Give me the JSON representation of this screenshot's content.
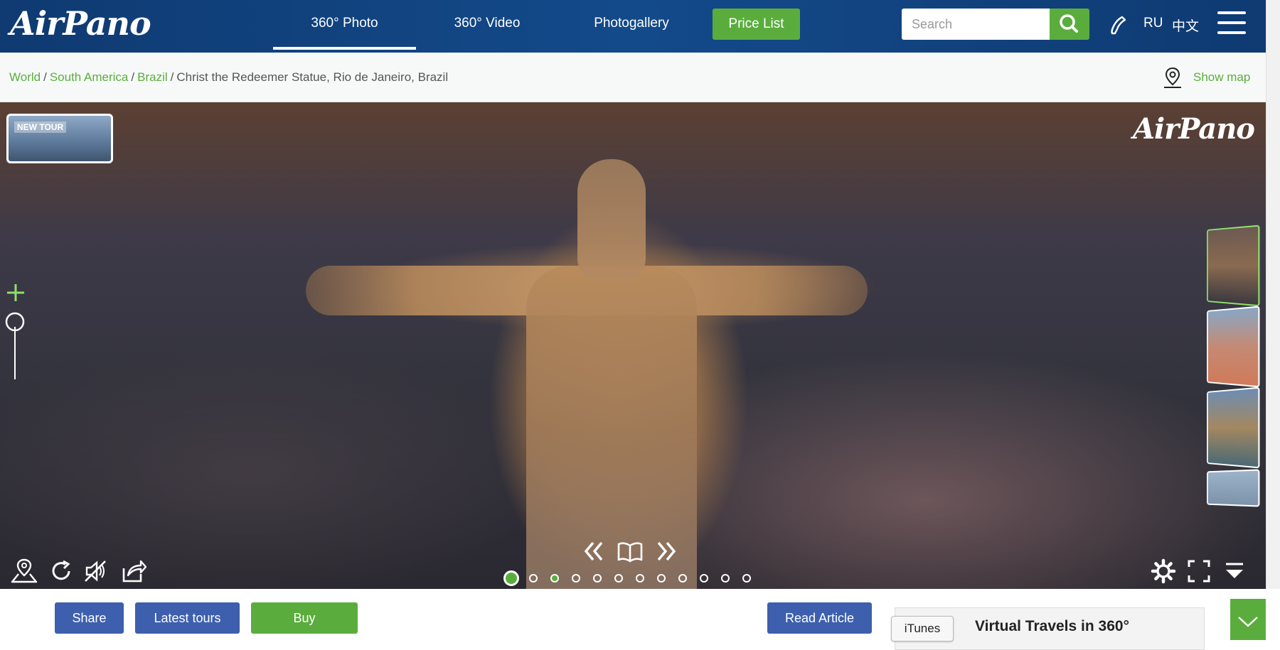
{
  "header": {
    "logo": "AirPano",
    "nav": [
      {
        "label": "360° Photo",
        "active": true
      },
      {
        "label": "360° Video",
        "active": false
      },
      {
        "label": "Photogallery",
        "active": false
      }
    ],
    "price_list": "Price List",
    "search": {
      "placeholder": "Search",
      "value": ""
    },
    "lang_ru": "RU",
    "lang_zh": "中文"
  },
  "breadcrumb": {
    "items": [
      "World",
      "South America",
      "Brazil"
    ],
    "current": "Christ the Redeemer Statue, Rio de Janeiro, Brazil",
    "separator": "/"
  },
  "show_map": "Show map",
  "viewer": {
    "new_tour_label": "NEW TOUR",
    "logo": "AirPano",
    "pager": {
      "total": 12,
      "current": 1,
      "seen": [
        3
      ]
    }
  },
  "bottom": {
    "share": "Share",
    "latest_tours": "Latest tours",
    "buy": "Buy",
    "read_article": "Read Article",
    "promo_title": "Virtual Travels in 360°",
    "itunes": "iTunes"
  },
  "colors": {
    "header_blue": "#134a8a",
    "accent_green": "#5aad3d",
    "button_blue": "#3d5fae"
  }
}
